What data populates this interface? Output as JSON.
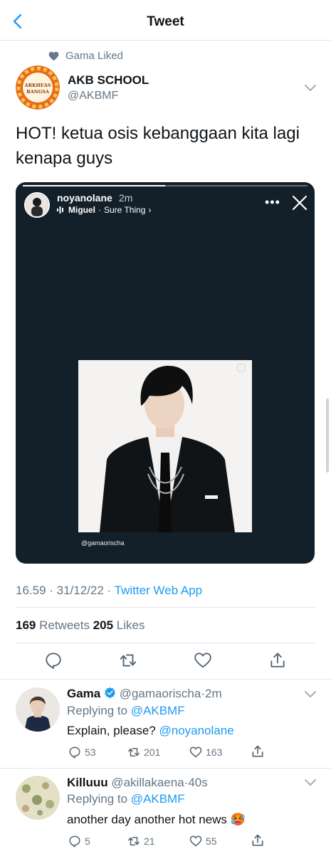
{
  "header": {
    "title": "Tweet",
    "back_icon": "chevron-left-icon"
  },
  "social_context": {
    "text": "Gama Liked"
  },
  "tweet": {
    "author_name": "AKB SCHOOL",
    "author_handle": "@AKBMF",
    "avatar_text_line1": "ARKHEAS",
    "avatar_text_line2": "BANGSA",
    "text": "HOT! ketua osis kebanggaan kita lagi kenapa guys",
    "timestamp": "16.59 · 31/12/22 · ",
    "source": "Twitter Web App",
    "retweets": "169",
    "retweets_label": " Retweets ",
    "likes": "205",
    "likes_label": " Likes"
  },
  "story": {
    "username": "noyanolane",
    "time": "2m",
    "music_artist": "Miguel",
    "music_title": "Sure Thing",
    "more": "•••",
    "credit": "@gamaorischa",
    "progress": 0.5
  },
  "replies": [
    {
      "name": "Gama",
      "handle": "@gamaorischa",
      "time": "2m",
      "verified": true,
      "replying_label": "Replying to ",
      "replying_to": "@AKBMF",
      "text": "Explain, please? ",
      "mention": "@noyanolane",
      "replies": "53",
      "retweets": "201",
      "likes": "163"
    },
    {
      "name": "Killuuu",
      "handle": "@akillakaena",
      "time": "40s",
      "verified": false,
      "replying_label": "Replying to ",
      "replying_to": "@AKBMF",
      "text": "another day another hot news 🥵",
      "mention": "",
      "replies": "5",
      "retweets": "21",
      "likes": "55"
    }
  ],
  "colors": {
    "accent": "#1d9bf0",
    "muted": "#657786",
    "media_bg": "#13202a"
  }
}
